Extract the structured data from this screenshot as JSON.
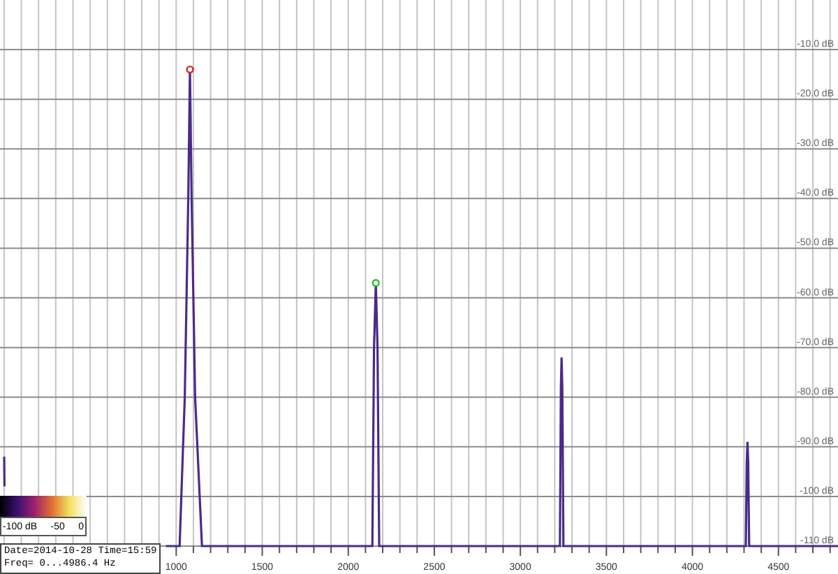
{
  "spectrum": {
    "chart_data": {
      "type": "line",
      "xlim": [
        -24,
        4846
      ],
      "ylim": [
        -110,
        0
      ],
      "xticks": [
        1000,
        1500,
        2000,
        2500,
        3000,
        3500,
        4000,
        4500
      ],
      "yticks": [
        {
          "value": -10,
          "label": "-10.0 dB"
        },
        {
          "value": -20,
          "label": "-20.0 dB"
        },
        {
          "value": -30,
          "label": "-30.0 dB"
        },
        {
          "value": -40,
          "label": "-40.0 dB"
        },
        {
          "value": -50,
          "label": "-50.0 dB"
        },
        {
          "value": -60,
          "label": "-60.0 dB"
        },
        {
          "value": -70,
          "label": "-70.0 dB"
        },
        {
          "value": -80,
          "label": "-80.0 dB"
        },
        {
          "value": -90,
          "label": "-90.0 dB"
        },
        {
          "value": -100,
          "label": "-100 dB"
        },
        {
          "value": -110,
          "label": "-110 dB"
        }
      ],
      "x": [
        0,
        2,
        940,
        1020,
        1050,
        1070,
        1080,
        1090,
        1110,
        1150,
        2140,
        2150,
        2160,
        2170,
        2180,
        3230,
        3236,
        3240,
        3244,
        3250,
        4310,
        4316,
        4320,
        4324,
        4330,
        4846
      ],
      "grid": true,
      "series": [
        {
          "color": "#4b2a8a",
          "values": [
            -92,
            -98,
            null,
            -110,
            -80,
            -40,
            -14,
            -40,
            -80,
            -110,
            -110,
            -70,
            -57,
            -70,
            -110,
            -110,
            -78,
            -72,
            -78,
            -110,
            -110,
            -93,
            -89,
            -93,
            -110,
            -110
          ]
        }
      ]
    },
    "peak_markers": [
      {
        "color": "#e02020"
      },
      {
        "color": "#22c022"
      }
    ]
  },
  "level_scale": {
    "labels": [
      "-100 dB",
      "-50",
      "0"
    ]
  },
  "info": {
    "lines": [
      "Date=2014-10-28 Time=15:59",
      "Freq= 0...4986.4 Hz"
    ]
  }
}
